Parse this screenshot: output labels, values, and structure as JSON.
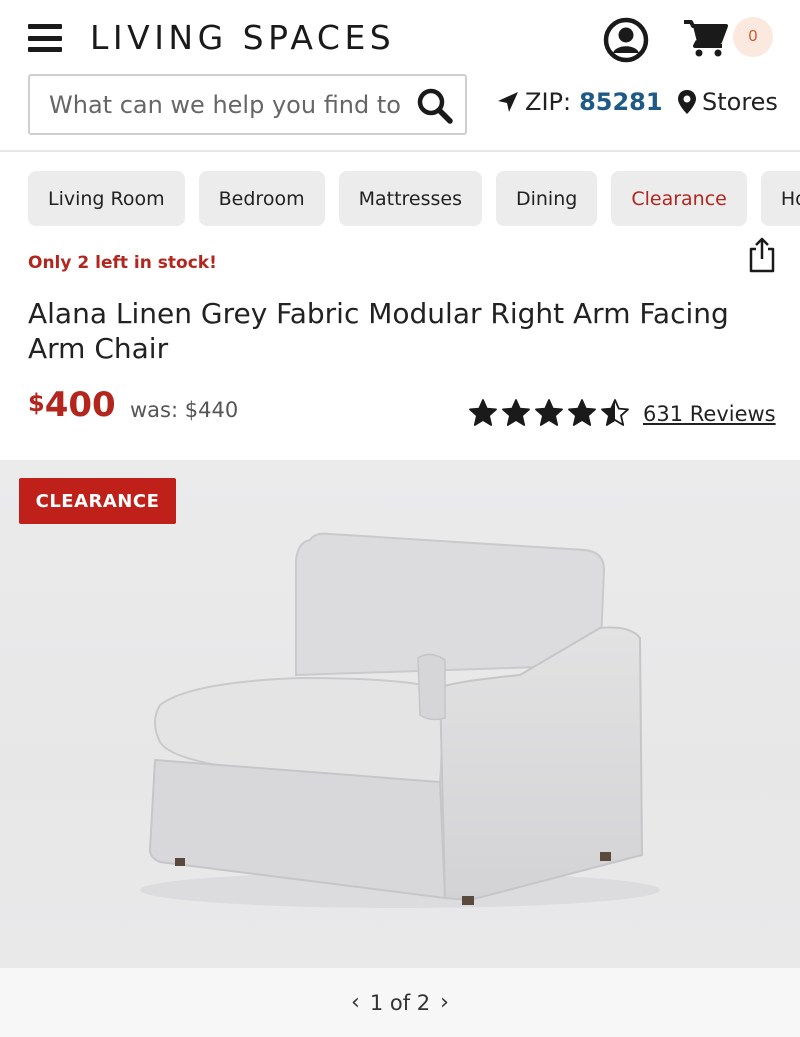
{
  "header": {
    "logo": "LIVING SPACES",
    "cart_count": "0",
    "search_placeholder": "What can we help you find today?",
    "zip_label": "ZIP:",
    "zip_code": "85281",
    "stores_label": "Stores"
  },
  "categories": [
    {
      "label": "Living Room"
    },
    {
      "label": "Bedroom"
    },
    {
      "label": "Mattresses"
    },
    {
      "label": "Dining"
    },
    {
      "label": "Clearance",
      "highlight": true
    },
    {
      "label": "Home Decor"
    }
  ],
  "product": {
    "stock_message": "Only 2 left in stock!",
    "title": "Alana Linen Grey Fabric Modular Right Arm Facing Arm Chair",
    "price_symbol": "$",
    "price": "400",
    "was_price": "was: $440",
    "rating": 4.5,
    "rating_max": 5,
    "reviews": "631 Reviews",
    "badge": "CLEARANCE"
  },
  "gallery": {
    "prev": "‹",
    "next": "›",
    "position": "1 of 2",
    "current": 1,
    "total": 2
  },
  "colors": {
    "accent_red": "#b3261e",
    "badge_red": "#c0201a",
    "zip_blue": "#1f5a86",
    "chip_bg": "#ececec"
  },
  "icons": [
    "menu-icon",
    "account-icon",
    "cart-icon",
    "search-icon",
    "location-arrow-icon",
    "map-pin-icon",
    "share-icon",
    "star-icon",
    "chevron-left-icon",
    "chevron-right-icon"
  ]
}
